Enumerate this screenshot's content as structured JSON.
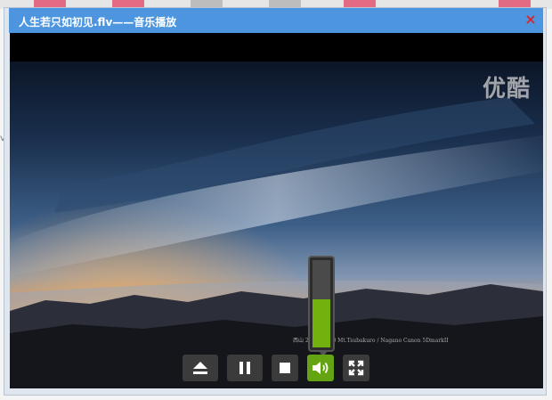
{
  "window": {
    "title": "人生若只如初见.flv——音乐播放",
    "close_symbol": "×"
  },
  "video": {
    "watermark": "优酷",
    "credit_line": "西山 2009.11.20 Mt.Tsubakuro / Nagano   Canon 5DmarkII"
  },
  "background": {
    "left_edge_text": "vi"
  },
  "controls": [
    {
      "name": "eject-button",
      "icon": "eject-icon"
    },
    {
      "name": "pause-button",
      "icon": "pause-icon"
    },
    {
      "name": "stop-button",
      "icon": "stop-icon"
    },
    {
      "name": "volume-button",
      "icon": "volume-icon",
      "active": true
    },
    {
      "name": "fullscreen-button",
      "icon": "fullscreen-icon"
    }
  ],
  "volume": {
    "level": 0.55
  },
  "colors": {
    "titlebar": "#4d96df",
    "accent_green": "#64a311",
    "close_red": "#d9262a"
  }
}
